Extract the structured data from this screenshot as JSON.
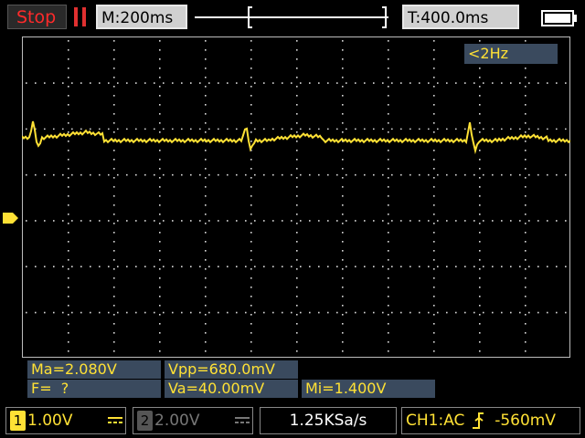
{
  "top": {
    "run_state": "Stop",
    "timebase": "M:200ms",
    "trigger_time": "T:400.0ms"
  },
  "readouts": {
    "frequency": "<2Hz"
  },
  "measurements": {
    "max": "Ma=2.080V",
    "vpp": "Vpp=680.0mV",
    "freq": "F=  ?",
    "avg": "Va=40.00mV",
    "min": "Mi=1.400V"
  },
  "bottom": {
    "ch1_badge": "1",
    "ch1_scale": "1.00V",
    "ch2_badge": "2",
    "ch2_scale": "2.00V",
    "sample_rate": "1.25KSa/s",
    "trigger_source": "CH1:AC",
    "trigger_level": "-560mV"
  },
  "colors": {
    "trace": "#ffe135",
    "grid": "#d8d8d8",
    "panel": "#3a4a5e"
  }
}
